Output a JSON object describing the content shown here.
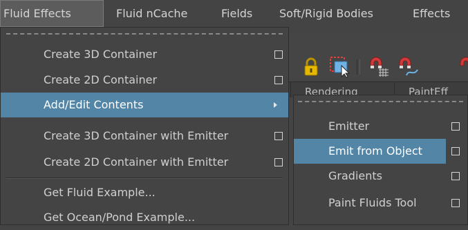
{
  "menubar": {
    "items": [
      {
        "label": "Fluid Effects"
      },
      {
        "label": "Fluid nCache"
      },
      {
        "label": "Fields"
      },
      {
        "label": "Soft/Rigid Bodies"
      },
      {
        "label": "Effects"
      }
    ],
    "active": "Fluid Effects"
  },
  "toolbar": {
    "icons": [
      "lock-icon",
      "select-camera-icon",
      "magnet-grid-icon",
      "magnet-curve-icon"
    ]
  },
  "tabs": [
    "Rendering",
    "PaintEff"
  ],
  "dropdown": {
    "items": [
      {
        "label": "Create 3D Container",
        "has_options": true
      },
      {
        "label": "Create 2D Container",
        "has_options": true
      },
      {
        "label": "Add/Edit Contents",
        "submenu": true,
        "selected": true
      },
      {
        "label": "Create 3D Container with Emitter",
        "has_options": true
      },
      {
        "label": "Create 2D Container with Emitter",
        "has_options": true
      },
      {
        "label": "Get Fluid Example..."
      },
      {
        "label": "Get Ocean/Pond Example..."
      }
    ]
  },
  "submenu": {
    "items": [
      {
        "label": "Emitter",
        "has_options": true
      },
      {
        "label": "Emit from Object",
        "has_options": true,
        "selected": true
      },
      {
        "label": "Gradients",
        "has_options": true
      },
      {
        "label": "Paint Fluids Tool",
        "has_options": true
      }
    ]
  },
  "colors": {
    "menu_bg": "#444444",
    "highlight": "#5285a6",
    "text": "#d0d0d0"
  }
}
